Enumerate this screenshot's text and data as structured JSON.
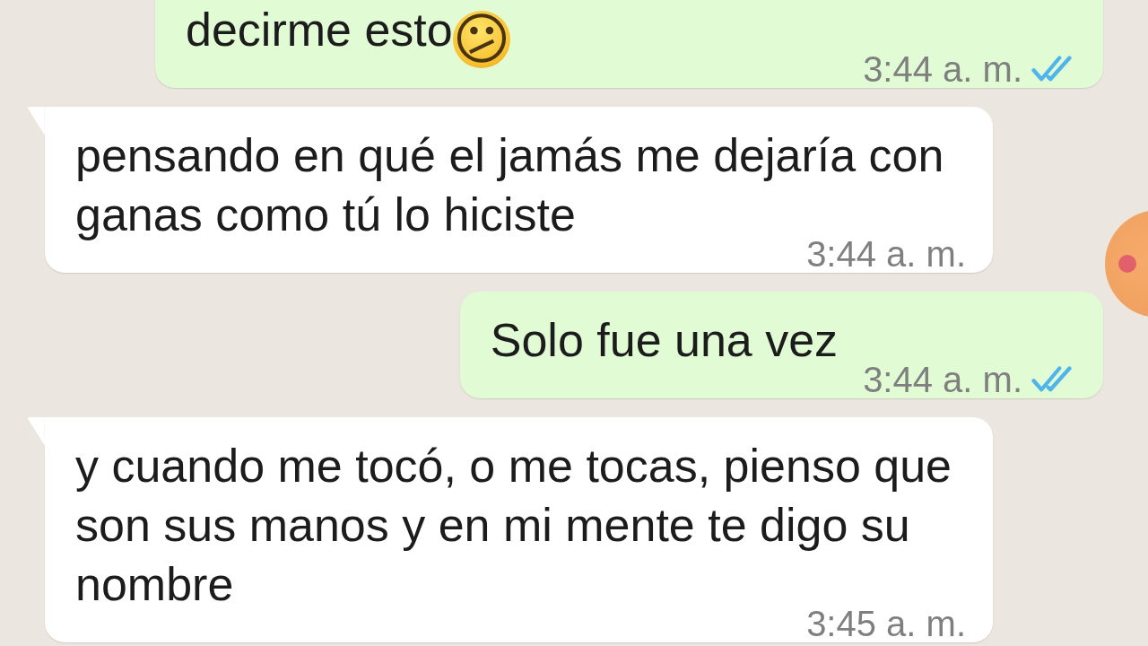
{
  "messages": [
    {
      "kind": "outgoing",
      "continued_above": true,
      "text": "decirme esto",
      "emoji": "😕",
      "time": "3:44 a. m.",
      "read": true
    },
    {
      "kind": "incoming",
      "continued_above": false,
      "text": "pensando en qué el jamás me dejaría con ganas como tú lo hiciste",
      "time": "3:44 a. m."
    },
    {
      "kind": "outgoing",
      "continued_above": false,
      "text": "Solo fue una vez",
      "time": "3:44 a. m.",
      "read": true
    },
    {
      "kind": "incoming",
      "continued_above": false,
      "text": "y cuando me tocó, o me tocas, pienso que son sus manos y en mi mente te digo su nombre",
      "time": "3:45 a. m."
    }
  ],
  "recording_overlay": true
}
